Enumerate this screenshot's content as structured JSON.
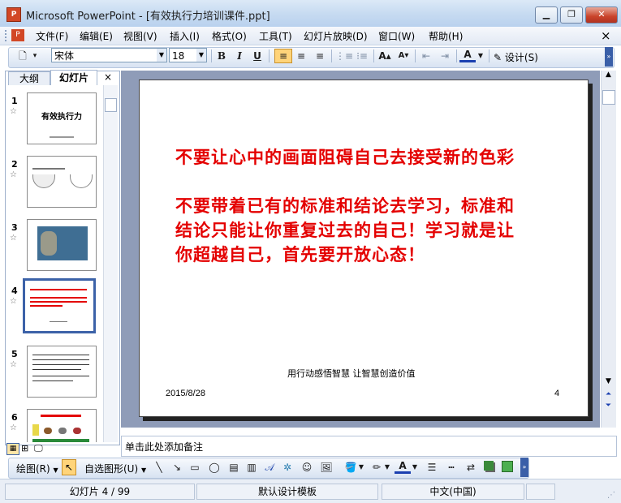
{
  "window": {
    "title": "Microsoft PowerPoint - [有效执行力培训课件.ppt]",
    "app_icon_glyph": "P"
  },
  "menu": {
    "items": [
      "文件(F)",
      "编辑(E)",
      "视图(V)",
      "插入(I)",
      "格式(O)",
      "工具(T)",
      "幻灯片放映(D)",
      "窗口(W)",
      "帮助(H)"
    ],
    "close_glyph": "×"
  },
  "toolbar": {
    "font": "宋体",
    "size": "18",
    "bold": "B",
    "italic": "I",
    "underline": "U",
    "design_label": "设计(S)"
  },
  "panel": {
    "tab_outline": "大纲",
    "tab_slides": "幻灯片",
    "close_glyph": "×"
  },
  "slides": [
    {
      "num": "1",
      "title": "有效执行力"
    },
    {
      "num": "2"
    },
    {
      "num": "3"
    },
    {
      "num": "4"
    },
    {
      "num": "5"
    },
    {
      "num": "6"
    }
  ],
  "current_slide": {
    "line1": "不要让心中的画面阻碍自己去接受新的色彩",
    "para2_line1": "不要带着已有的标准和结论去学习，标准和",
    "para2_line2": "结论只能让你重复过去的自己！学习就是让",
    "para2_line3": "你超越自己，首先要开放心态！",
    "footer_center": "用行动感悟智慧 让智慧创造价值",
    "date": "2015/8/28",
    "page_number": "4"
  },
  "notes": {
    "placeholder": "单击此处添加备注"
  },
  "drawbar": {
    "draw_label": "绘图(R)",
    "autoshape_label": "自选图形(U)"
  },
  "status": {
    "slide_info": "幻灯片 4 / 99",
    "template": "默认设计模板",
    "language": "中文(中国)"
  },
  "colors": {
    "slide_text_red": "#e40000",
    "selected_thumb_border": "#3c62a8"
  }
}
